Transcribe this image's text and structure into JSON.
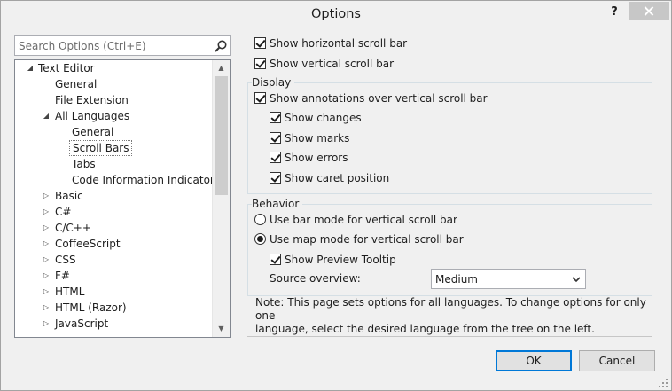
{
  "window": {
    "title": "Options",
    "help_label": "?"
  },
  "search": {
    "placeholder": "Search Options (Ctrl+E)",
    "value": ""
  },
  "tree": {
    "items": [
      {
        "label": "Text Editor",
        "level": 0,
        "expanded": true
      },
      {
        "label": "General",
        "level": 1
      },
      {
        "label": "File Extension",
        "level": 1
      },
      {
        "label": "All Languages",
        "level": 1,
        "expanded": true
      },
      {
        "label": "General",
        "level": 2
      },
      {
        "label": "Scroll Bars",
        "level": 2,
        "selected": true
      },
      {
        "label": "Tabs",
        "level": 2
      },
      {
        "label": "Code Information Indicators",
        "level": 2
      },
      {
        "label": "Basic",
        "level": 1,
        "expanded": false
      },
      {
        "label": "C#",
        "level": 1,
        "expanded": false
      },
      {
        "label": "C/C++",
        "level": 1,
        "expanded": false
      },
      {
        "label": "CoffeeScript",
        "level": 1,
        "expanded": false
      },
      {
        "label": "CSS",
        "level": 1,
        "expanded": false
      },
      {
        "label": "F#",
        "level": 1,
        "expanded": false
      },
      {
        "label": "HTML",
        "level": 1,
        "expanded": false
      },
      {
        "label": "HTML (Razor)",
        "level": 1,
        "expanded": false
      },
      {
        "label": "JavaScript",
        "level": 1,
        "expanded": false
      }
    ]
  },
  "options": {
    "show_horizontal": {
      "label": "Show horizontal scroll bar",
      "checked": true
    },
    "show_vertical": {
      "label": "Show vertical scroll bar",
      "checked": true
    }
  },
  "display": {
    "title": "Display",
    "show_annotations": {
      "label": "Show annotations over vertical scroll bar",
      "checked": true
    },
    "show_changes": {
      "label": "Show changes",
      "checked": true
    },
    "show_marks": {
      "label": "Show marks",
      "checked": true
    },
    "show_errors": {
      "label": "Show errors",
      "checked": true
    },
    "show_caret": {
      "label": "Show caret position",
      "checked": true
    }
  },
  "behavior": {
    "title": "Behavior",
    "bar_mode": {
      "label": "Use bar mode for vertical scroll bar",
      "checked": false
    },
    "map_mode": {
      "label": "Use map mode for vertical scroll bar",
      "checked": true
    },
    "preview_tooltip": {
      "label": "Show Preview Tooltip",
      "checked": true
    },
    "source_overview_label": "Source overview:",
    "source_overview_value": "Medium"
  },
  "note": {
    "line1": "Note: This page sets options for all languages. To change options for only one",
    "line2": "language, select the desired language from the tree on the left."
  },
  "buttons": {
    "ok": "OK",
    "cancel": "Cancel"
  }
}
